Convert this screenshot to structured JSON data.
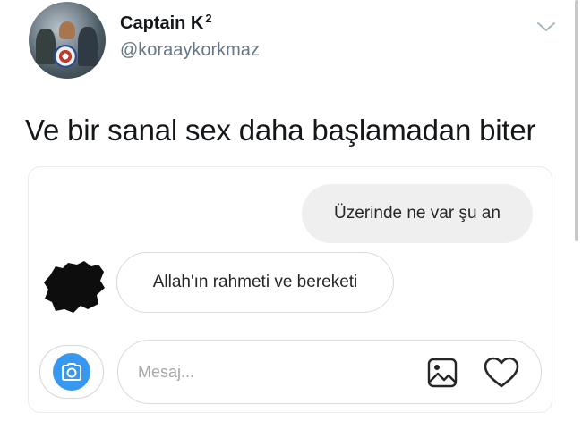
{
  "tweet": {
    "author": {
      "display_name": "Captain K",
      "display_name_suffix": "2",
      "handle": "@koraaykorkmaz",
      "avatar_icon": "captain-america-avatar"
    },
    "text": "Ve bir sanal sex daha başlamadan biter",
    "menu_icon": "chevron-down-icon"
  },
  "chat": {
    "messages": [
      {
        "direction": "outgoing",
        "text": "Üzerinde ne var şu an"
      },
      {
        "direction": "incoming",
        "text": "Allah'ın rahmeti ve bereketi"
      }
    ],
    "composer": {
      "placeholder": "Mesaj...",
      "camera_icon": "camera-icon",
      "gallery_icon": "image-gallery-icon",
      "like_icon": "heart-icon"
    }
  },
  "colors": {
    "accent_blue": "#3897f0",
    "outgoing_bubble": "#efefef",
    "handle_gray": "#657786",
    "text_dark": "#14171a"
  }
}
